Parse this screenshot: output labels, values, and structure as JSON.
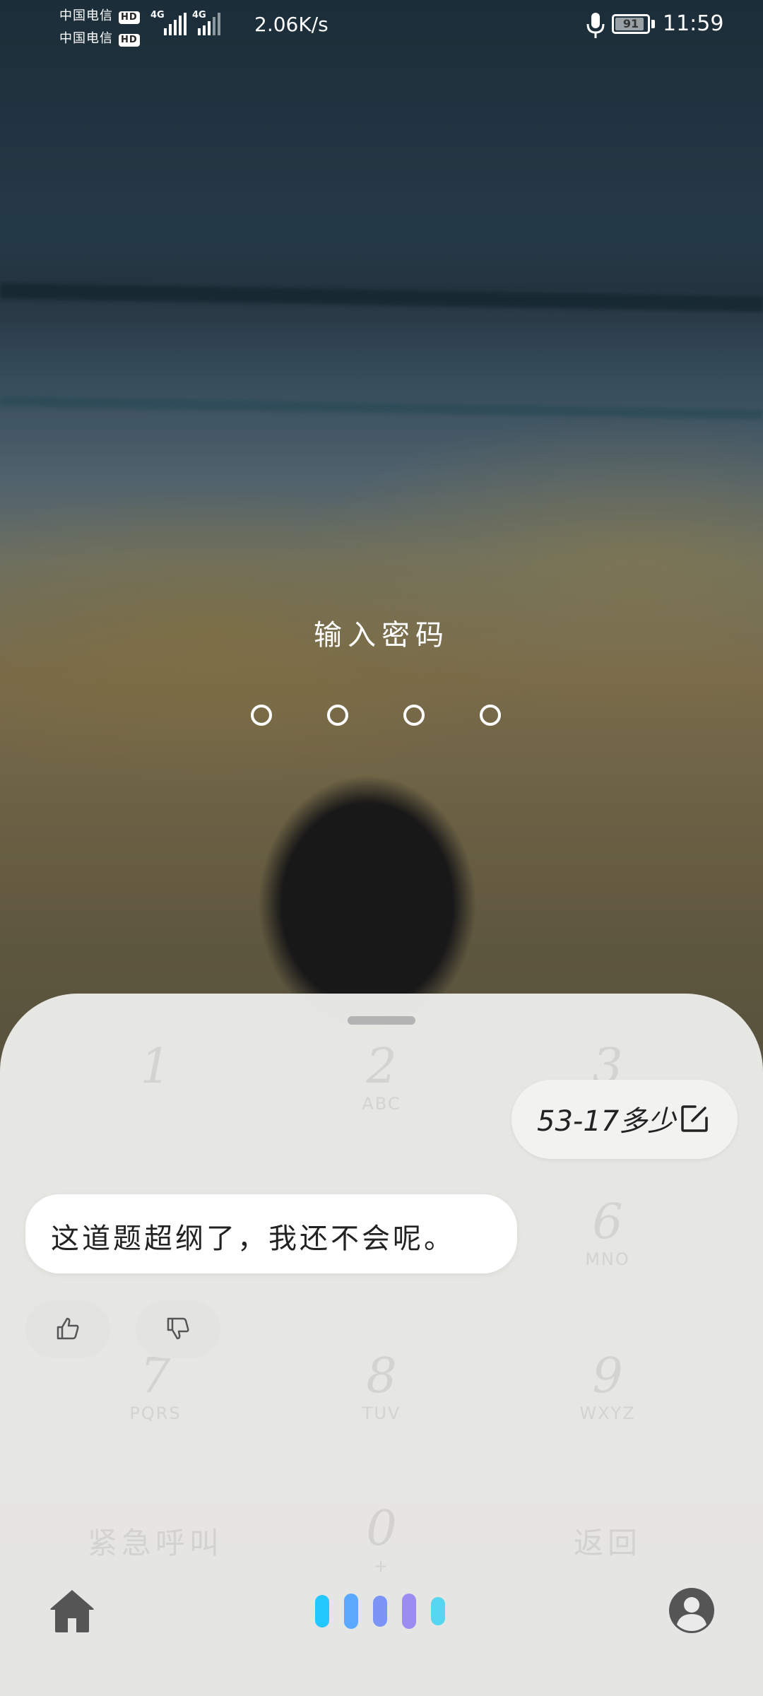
{
  "status_bar": {
    "carrier1": "中国电信",
    "carrier2": "中国电信",
    "hd_badge": "HD",
    "network1": "4G",
    "network2": "4G",
    "speed": "2.06K/s",
    "battery_level": "91",
    "time": "11:59"
  },
  "lock": {
    "title": "输入密码",
    "pin_length": 4
  },
  "keypad": {
    "keys": [
      {
        "num": "1",
        "sub": ""
      },
      {
        "num": "2",
        "sub": "ABC"
      },
      {
        "num": "3",
        "sub": ""
      },
      {
        "num": "6",
        "sub": "MNO"
      },
      {
        "num": "7",
        "sub": "PQRS"
      },
      {
        "num": "8",
        "sub": "TUV"
      },
      {
        "num": "9",
        "sub": "WXYZ"
      },
      {
        "num": "0",
        "sub": "+"
      }
    ],
    "emergency": "紧急呼叫",
    "back": "返回"
  },
  "chat": {
    "user_query": "53-17多少",
    "assistant_reply": "这道题超纲了，我还不会呢。"
  },
  "icons": {
    "edit": "edit-icon",
    "thumbs_up": "thumbs-up-icon",
    "thumbs_down": "thumbs-down-icon",
    "home": "home-icon",
    "assistant": "voice-assistant-icon",
    "avatar": "user-avatar-icon"
  },
  "colors": {
    "assistant_gradient": [
      "#22c8ff",
      "#5aa8ff",
      "#7c94f5",
      "#9a8cf0",
      "#56d6f0"
    ]
  }
}
